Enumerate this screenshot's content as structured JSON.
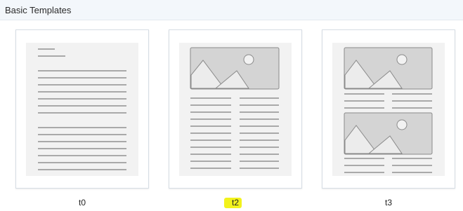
{
  "header": {
    "title": "Basic Templates"
  },
  "templates": [
    {
      "label": "t0",
      "icon": "text-document-icon"
    },
    {
      "label": "t2",
      "icon": "image-two-column-text-icon",
      "highlighted": true
    },
    {
      "label": "t3",
      "icon": "two-images-two-column-text-icon"
    }
  ],
  "colors": {
    "header_bg": "#f3f7fb",
    "page_bg": "#f2f2f2",
    "text_line": "#a9a9a9",
    "image_fill": "#d4d4d4",
    "highlight": "#f2f21c"
  }
}
